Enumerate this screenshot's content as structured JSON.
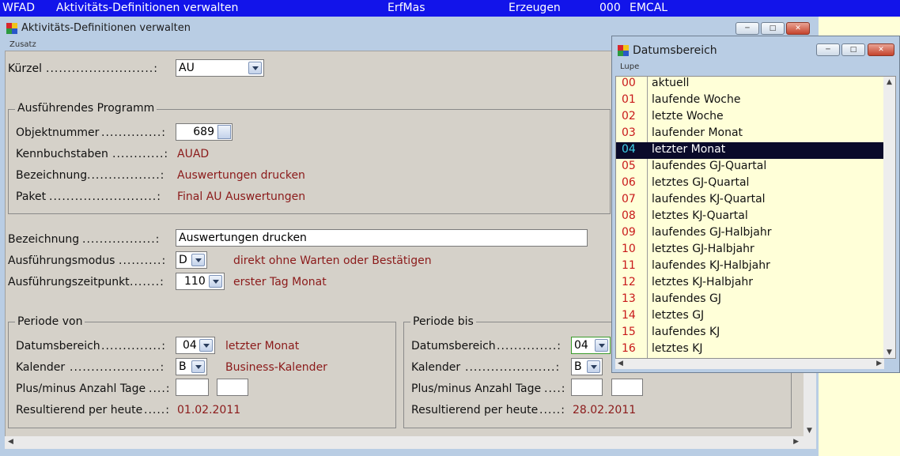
{
  "topbar": {
    "code": "WFAD",
    "title": "Aktivitäts-Definitionen verwalten",
    "mode": "ErfMas",
    "action": "Erzeugen",
    "number": "000",
    "user": "EMCAL"
  },
  "window": {
    "title": "Aktivitäts-Definitionen verwalten",
    "menu": "Zusatz",
    "controls": [
      "minimize",
      "maximize",
      "close"
    ]
  },
  "form": {
    "kuerzel": {
      "label": "Kürzel",
      "value": "AU"
    },
    "programm": {
      "group_title": "Ausführendes Programm",
      "objektnummer": {
        "label": "Objektnummer",
        "value": "689"
      },
      "kennbuchstaben": {
        "label": "Kennbuchstaben",
        "value": "AUAD"
      },
      "bezeichnung": {
        "label": "Bezeichnung",
        "value": "Auswertungen drucken"
      },
      "paket": {
        "label": "Paket",
        "value": "Final AU Auswertungen"
      }
    },
    "bezeichnung": {
      "label": "Bezeichnung",
      "value": "Auswertungen drucken"
    },
    "modus": {
      "label": "Ausführungsmodus",
      "value": "D",
      "desc": "direkt ohne Warten oder Bestätigen"
    },
    "zeitpunkt": {
      "label": "Ausführungszeitpunkt",
      "value": "110",
      "desc": "erster Tag Monat"
    },
    "von": {
      "group_title": "Periode von",
      "datumsbereich": {
        "label": "Datumsbereich",
        "value": "04",
        "desc": "letzter Monat"
      },
      "kalender": {
        "label": "Kalender",
        "value": "B",
        "desc": "Business-Kalender"
      },
      "plusminus": {
        "label": "Plus/minus Anzahl Tage",
        "value1": "",
        "value2": ""
      },
      "resultierend": {
        "label": "Resultierend per heute",
        "value": "01.02.2011"
      }
    },
    "bis": {
      "group_title": "Periode bis",
      "datumsbereich": {
        "label": "Datumsbereich",
        "value": "04"
      },
      "kalender": {
        "label": "Kalender",
        "value": "B"
      },
      "plusminus": {
        "label": "Plus/minus Anzahl Tage",
        "value1": "",
        "value2": ""
      },
      "resultierend": {
        "label": "Resultierend per heute",
        "value": "28.02.2011"
      }
    }
  },
  "popup": {
    "title": "Datumsbereich",
    "menu": "Lupe",
    "selected_index": 4,
    "items": [
      {
        "code": "00",
        "text": "aktuell"
      },
      {
        "code": "01",
        "text": "laufende Woche"
      },
      {
        "code": "02",
        "text": "letzte Woche"
      },
      {
        "code": "03",
        "text": "laufender Monat"
      },
      {
        "code": "04",
        "text": "letzter Monat"
      },
      {
        "code": "05",
        "text": "laufendes GJ-Quartal"
      },
      {
        "code": "06",
        "text": "letztes GJ-Quartal"
      },
      {
        "code": "07",
        "text": "laufendes KJ-Quartal"
      },
      {
        "code": "08",
        "text": "letztes KJ-Quartal"
      },
      {
        "code": "09",
        "text": "laufendes GJ-Halbjahr"
      },
      {
        "code": "10",
        "text": "letztes GJ-Halbjahr"
      },
      {
        "code": "11",
        "text": "laufendes KJ-Halbjahr"
      },
      {
        "code": "12",
        "text": "letztes KJ-Halbjahr"
      },
      {
        "code": "13",
        "text": "laufendes GJ"
      },
      {
        "code": "14",
        "text": "letztes GJ"
      },
      {
        "code": "15",
        "text": "laufendes KJ"
      },
      {
        "code": "16",
        "text": "letztes KJ"
      }
    ]
  },
  "colors": {
    "topbar_bg": "#1214ea",
    "value_text": "#8b1a1a",
    "list_code": "#c8191a",
    "list_selected_bg": "#0a0a2a",
    "list_selected_code": "#3fd1e8",
    "list_bg": "#ffffd8"
  }
}
